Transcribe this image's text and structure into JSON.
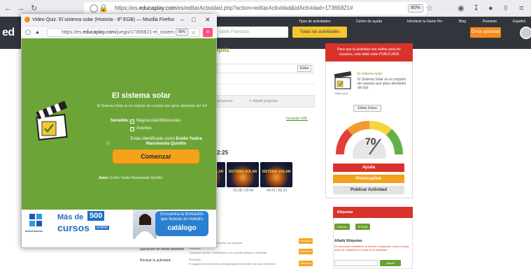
{
  "browser": {
    "url_prefix": "https://es.",
    "url_domain": "educaplay.com",
    "url_rest": "/es/editarActividad.php?action=editarActividad&idActividad=17365821#",
    "zoom": "80%"
  },
  "site": {
    "logo": "ed",
    "search_placeholder": "spido Francisco",
    "all_activities": "Todas las actividades",
    "create_activity": "Crear actividad",
    "topnav": [
      "Tipos de actividades",
      "Centro de ayuda",
      "Introducir tu Game Pin",
      "Blog",
      "Premium",
      "Español"
    ]
  },
  "editor": {
    "title_fragment": "quiz",
    "edit_button": "Editar",
    "tabs": [
      "secuencia",
      "3. Añadir pregunta"
    ],
    "link": "Incrustar URL",
    "time_fragment": "2:25",
    "thumbnails": [
      {
        "label": "SISTEMA SOLAR",
        "time": ""
      },
      {
        "label": "SISTEMA SOLAR",
        "time": "03:28 / 03:49"
      },
      {
        "label": "SISTEMA SOLAR",
        "time": "04:41 / 05:10"
      }
    ],
    "settings": [
      {
        "label": "Privacidad",
        "value": "Pública",
        "desc": "Visible y disponible para todos los usuarios",
        "badge": "Premium"
      },
      {
        "label": "Ejecución en modo anónimo",
        "value": "Permitido",
        "desc": "Cualquier usuario, identificado o no, puede realizar la actividad",
        "badge": "Premium"
      },
      {
        "label": "Revisar la actividad",
        "value": "Permitido",
        "desc": "El jugador al terminar la actividad aparecerá visible en línea momento",
        "badge": "Premium"
      }
    ]
  },
  "right_panel": {
    "banner": "Para que la actividad sea visible para los usuarios, esta debe estar PUBLICADA",
    "activity_title": "El sistema solar",
    "activity_desc": "El Sistema Solar es el conjunto de cuerpos que giran alrededor del Sol.",
    "activity_type": "Video Quiz",
    "edit_data": "Editar Datos",
    "score": "70",
    "help": "Ayuda",
    "preview": "Previsualizar",
    "publish": "Publicar Actividad",
    "tags_title": "Etiquetas",
    "tags": [
      "Historia",
      "8º EGB"
    ],
    "add_tags": "Añadir Etiquetas",
    "tags_warning": "Es necesario establecer al menos 3 etiquetas. Una en estas debe de establecer el tema de la actividad.",
    "tags_add_btn": "Añadir"
  },
  "popup": {
    "window_title": "Video Quiz: El sistema solar (Historia - 8º EGB) — Mozilla Firefox",
    "url_prefix": "https://es.",
    "url_domain": "educaplay.com",
    "url_rest": "/juego/17365821-el_sistem",
    "zoom": "80%",
    "quiz_title": "El sistema solar",
    "quiz_desc": "El Sistema Solar es el conjunto de cuerpos que giran alrededor del Sol",
    "sensitive_label": "Sensible:",
    "options": [
      "Mayúsculas/Minúsculas",
      "Acentos"
    ],
    "identified_prefix": "Estás identificado como",
    "identified_name": "Evelin Yadira Manobanda Quinllin",
    "start_button": "Comenzar",
    "author_label": "Autor:",
    "author_name": "Evelin Yadira Manobanda Quinllin"
  },
  "ad": {
    "brand": "adrformación",
    "mas": "Más de",
    "count": "500",
    "cursos": "cursos",
    "online": "online",
    "bubble_line1": "Encuentra la formación que buscas en nuestro",
    "bubble_line2": "catálogo"
  },
  "colors": {
    "quiz_green": "#6da438",
    "accent_red": "#d9322b",
    "accent_orange": "#f4a21a",
    "header_dark": "#32353b"
  }
}
